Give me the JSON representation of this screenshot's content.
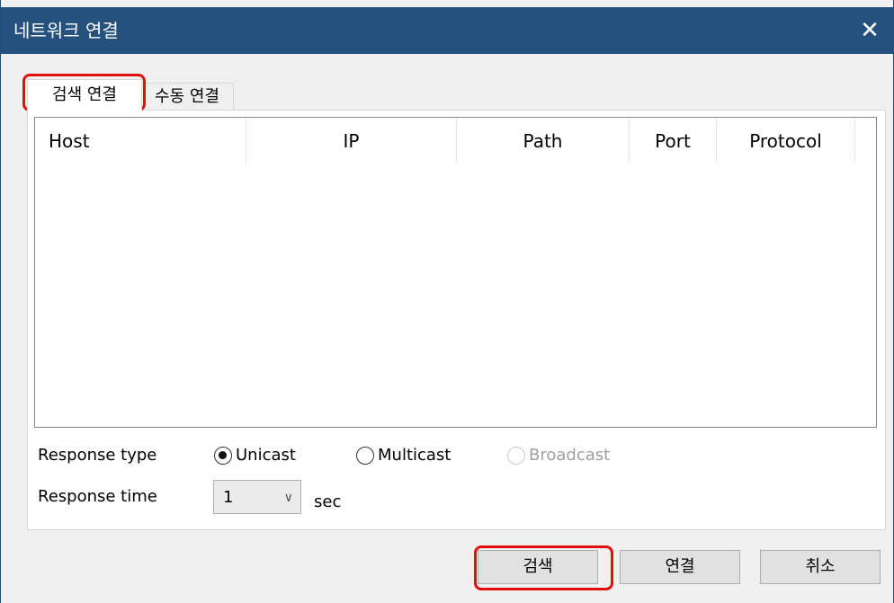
{
  "window": {
    "title": "네트워크 연결",
    "close_glyph": "✕"
  },
  "tabs": [
    {
      "label": "검색 연결",
      "active": true
    },
    {
      "label": "수동 연결",
      "active": false
    }
  ],
  "list": {
    "columns": [
      "Host",
      "IP",
      "Path",
      "Port",
      "Protocol"
    ],
    "rows": []
  },
  "response_type": {
    "label": "Response type",
    "options": [
      {
        "label": "Unicast",
        "checked": true,
        "enabled": true
      },
      {
        "label": "Multicast",
        "checked": false,
        "enabled": true
      },
      {
        "label": "Broadcast",
        "checked": false,
        "enabled": false
      }
    ]
  },
  "response_time": {
    "label": "Response time",
    "value": "1",
    "unit": "sec"
  },
  "buttons": {
    "search": "검색",
    "connect": "연결",
    "cancel": "취소"
  },
  "colors": {
    "titlebar": "#24517e",
    "highlight": "#e01010"
  },
  "icons": {
    "close": "close-icon",
    "dropdown": "chevron-down-icon"
  }
}
